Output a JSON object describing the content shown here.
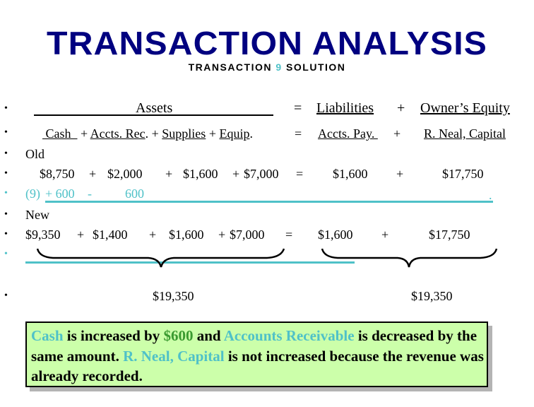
{
  "header": {
    "title": "TRANSACTION ANALYSIS",
    "subtitle_prefix": "TRANSACTION ",
    "subtitle_number": "9",
    "subtitle_suffix": " SOLUTION"
  },
  "equation": {
    "bullet": "•",
    "row1": {
      "assets": "Assets",
      "eq": "=",
      "liabilities": "Liabilities",
      "plus": "+",
      "owners_equity": "Owner’s Equity"
    },
    "row2": {
      "cash": " Cash  ",
      "p1": "+",
      "accts_rec": "Accts. Rec",
      "dot1": ".",
      "p2": "+",
      "supplies": "Supplies",
      "p3": "+",
      "equip": "Equip",
      "dot2": ".",
      "eq": "=",
      "accts_pay": "Accts. Pay. ",
      "plus": "+",
      "capital": "R. Neal, Capital"
    },
    "old_label": "Old",
    "old_row": {
      "cash": "$8,750",
      "p1": "+",
      "accts_rec": "$2,000",
      "p2": "+",
      "supplies": "$1,600",
      "p3": "+",
      "equip": "$7,000",
      "eq": "=",
      "accts_pay": "$1,600",
      "plus": "+",
      "capital": "$17,750"
    },
    "change_row": {
      "label": "(9)",
      "cash": "+ 600",
      "minus": "-",
      "accts_rec": "600",
      "end_dot": "."
    },
    "new_label": "New",
    "new_row": {
      "cash": "$9,350",
      "p1": "+",
      "accts_rec": "$1,400",
      "p2": "+",
      "supplies": "$1,600",
      "p3": "+",
      "equip": "$7,000",
      "eq": "=",
      "accts_pay": "$1,600",
      "plus": "+",
      "capital": "$17,750"
    },
    "totals": {
      "assets_total": "$19,350",
      "liab_equity_total": "$19,350"
    }
  },
  "note": {
    "seg1": "Cash",
    "seg2": " is increased by ",
    "seg3": "$600",
    "seg4": " and ",
    "seg5": "Accounts Receivable",
    "seg6": " is decreased by the same amount.  ",
    "seg7": "R. Neal, Capital",
    "seg8": " is not increased because the revenue was already recorded."
  }
}
